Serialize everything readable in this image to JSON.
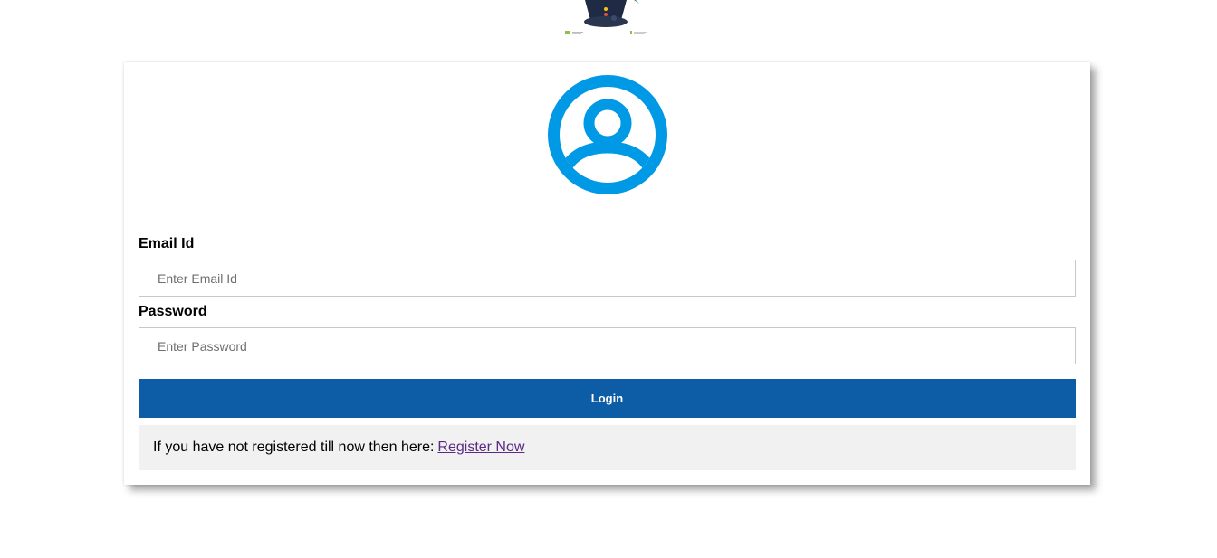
{
  "colors": {
    "accent": "#0099e5",
    "button": "#0d5ca6",
    "link": "#5a2a84",
    "register_bg": "#f1f1f1"
  },
  "form": {
    "email_label": "Email Id",
    "email_placeholder": "Enter Email Id",
    "email_value": "",
    "password_label": "Password",
    "password_placeholder": "Enter Password",
    "password_value": "",
    "login_label": "Login"
  },
  "register": {
    "prompt": "If you have not registered till now then here:",
    "link_label": "Register Now"
  },
  "icons": {
    "avatar": "user-circle-icon",
    "banner": "mascot-logo-icon"
  }
}
